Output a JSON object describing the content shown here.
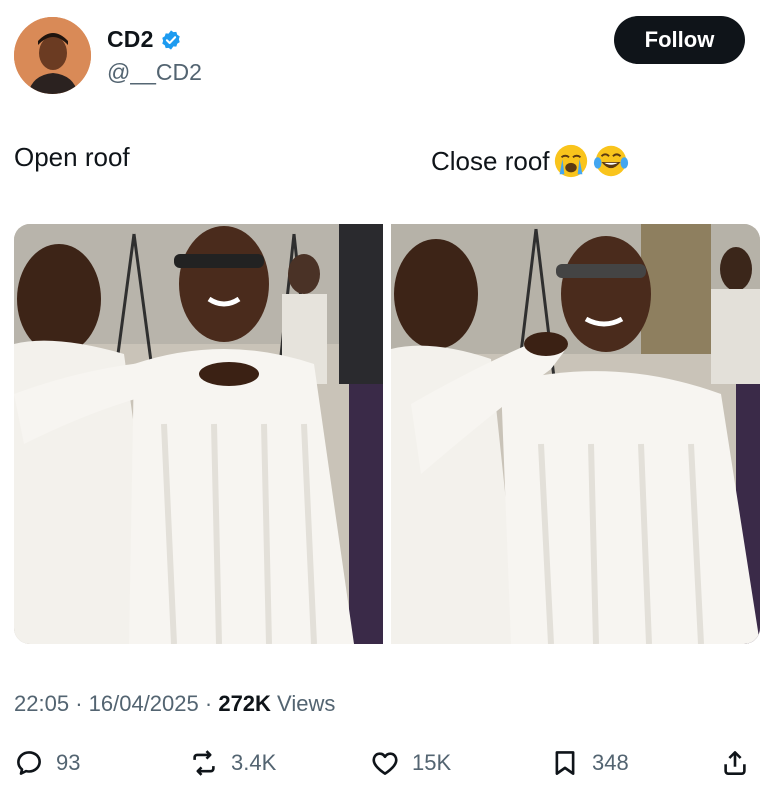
{
  "author": {
    "name": "CD2",
    "handle": "@__CD2",
    "verified_icon": "verified-badge-icon",
    "accent": "#1d9bf0"
  },
  "follow": {
    "label": "Follow"
  },
  "captions": {
    "left": "Open roof",
    "right": "Close roof",
    "right_emojis": [
      "loudly-crying-face-emoji",
      "tears-of-joy-emoji"
    ]
  },
  "media": {
    "left_image": "photo-open-roof",
    "right_image": "photo-close-roof"
  },
  "meta": {
    "time": "22:05",
    "date": "16/04/2025",
    "views_count": "272K",
    "views_label": "Views",
    "separator": "·"
  },
  "actions": {
    "replies": "93",
    "reposts": "3.4K",
    "likes": "15K",
    "bookmarks": "348"
  }
}
